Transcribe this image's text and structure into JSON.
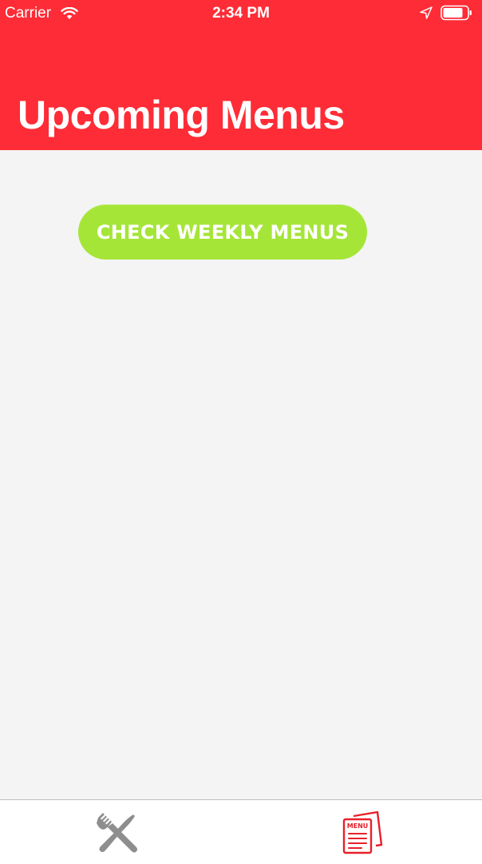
{
  "status_bar": {
    "carrier": "Carrier",
    "time": "2:34 PM",
    "wifi_icon": "wifi-icon",
    "location_icon": "location-arrow-icon",
    "battery_icon": "battery-icon"
  },
  "header": {
    "title": "Upcoming Menus",
    "background_color": "#fe2c36"
  },
  "main": {
    "weekly_button_label": "CHECK WEEKLY MENUS",
    "button_color": "#a5e538",
    "background_color": "#f4f4f4"
  },
  "tab_bar": {
    "tabs": [
      {
        "icon": "fork-knife-icon",
        "selected": false,
        "color": "#8e8e8e"
      },
      {
        "icon": "menu-icon",
        "icon_text": "MENU",
        "selected": true,
        "color": "#e8202a"
      }
    ]
  }
}
